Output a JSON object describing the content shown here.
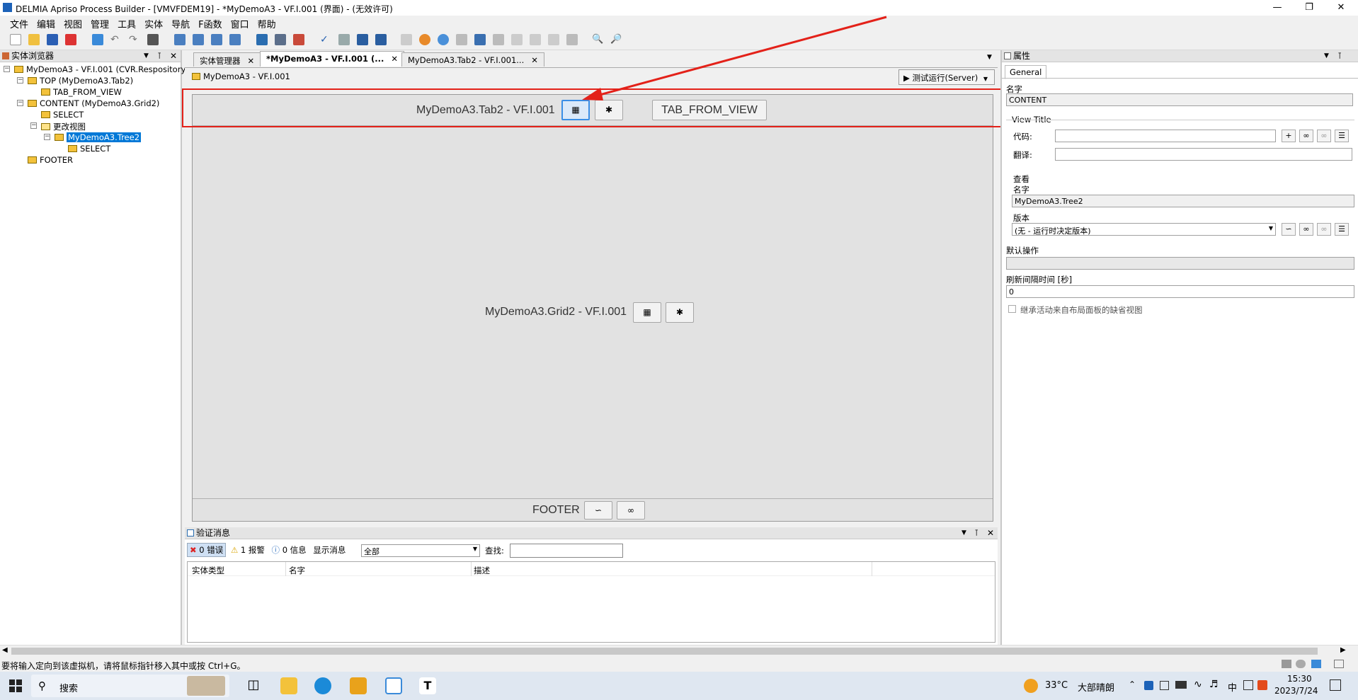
{
  "window": {
    "title": "DELMIA Apriso Process Builder - [VMVFDEM19] - *MyDemoA3 - VF.I.001 (界面) - (无效许可)"
  },
  "menu": [
    "文件",
    "编辑",
    "视图",
    "管理",
    "工具",
    "实体",
    "导航",
    "F函数",
    "窗口",
    "帮助"
  ],
  "left_panel": {
    "title": "实体浏览器",
    "tree": [
      {
        "label": "MyDemoA3 - VF.I.001 (CVR.Respository_"
      },
      {
        "label": "TOP (MyDemoA3.Tab2)"
      },
      {
        "label": "TAB_FROM_VIEW"
      },
      {
        "label": "CONTENT (MyDemoA3.Grid2)"
      },
      {
        "label": "SELECT"
      },
      {
        "label": "更改视图"
      },
      {
        "label": "MyDemoA3.Tree2"
      },
      {
        "label": "SELECT"
      },
      {
        "label": "FOOTER"
      }
    ]
  },
  "tabs": [
    {
      "label": "实体管理器"
    },
    {
      "label": "*MyDemoA3 - VF.I.001 (..."
    },
    {
      "label": "MyDemoA3.Tab2 - VF.I.001..."
    }
  ],
  "editor": {
    "breadcrumb": "MyDemoA3 - VF.I.001",
    "run_button": "测试运行(Server)",
    "top_zone_label": "MyDemoA3.Tab2 - VF.I.001",
    "tab_from_view_button": "TAB_FROM_VIEW",
    "content_zone_label": "MyDemoA3.Grid2 - VF.I.001",
    "footer_label": "FOOTER"
  },
  "validation": {
    "title": "验证消息",
    "errors": "0 错误",
    "warnings": "1 报警",
    "info": "0 信息",
    "show_label": "显示消息",
    "filter": "全部",
    "search_label": "查找:",
    "columns": [
      "实体类型",
      "名字",
      "描述"
    ]
  },
  "properties": {
    "title": "属性",
    "tab": "General",
    "name_label": "名字",
    "name_value": "CONTENT",
    "view_title_group": "View Title",
    "code_label": "代码:",
    "translate_label": "翻译:",
    "view_group": "查看",
    "view_name_label": "名字",
    "view_name_value": "MyDemoA3.Tree2",
    "version_label": "版本",
    "version_value": "(无 - 运行时决定版本)",
    "default_op_label": "默认操作",
    "refresh_label": "刷新间隔时间 [秒]",
    "refresh_value": "0",
    "inherit_label": "继承活动来自布局面板的缺省视图"
  },
  "status_bar": "要将输入定向到该虚拟机，请将鼠标指针移入其中或按 Ctrl+G。",
  "taskbar": {
    "search": "搜索",
    "weather_temp": "33°C",
    "weather_desc": "大部晴朗",
    "ime": "中",
    "time": "15:30",
    "date": "2023/7/24"
  },
  "colors": {
    "annotation_red": "#e32119",
    "selection_blue": "#0078d7",
    "accent_blue": "#1c62b8"
  }
}
